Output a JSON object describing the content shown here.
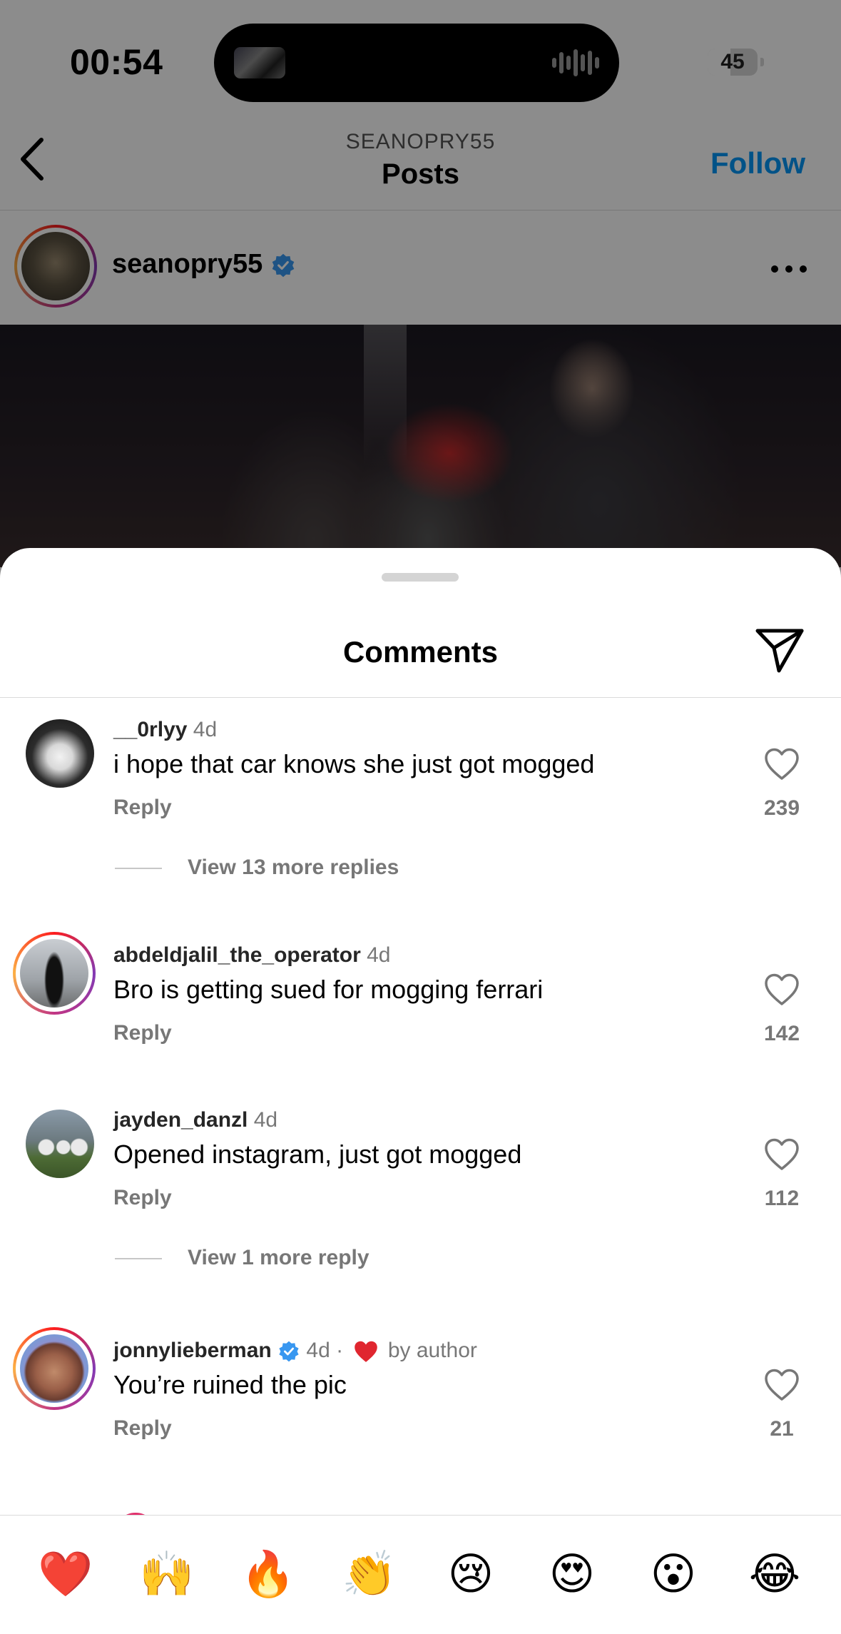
{
  "status_bar": {
    "time": "00:54",
    "battery": "45",
    "battery_level": 0.45
  },
  "nav": {
    "subtitle": "SEANOPRY55",
    "title": "Posts",
    "follow_label": "Follow"
  },
  "post": {
    "username": "seanopry55",
    "verified": true
  },
  "sheet": {
    "title": "Comments"
  },
  "comments": [
    {
      "username": "__0rlyy",
      "time": "4d",
      "text": "i hope that car knows she just got mogged",
      "reply_label": "Reply",
      "likes": "239",
      "more_replies": "View 13 more replies"
    },
    {
      "username": "abdeldjalil_the_operator",
      "time": "4d",
      "text": "Bro is getting sued for mogging ferrari",
      "reply_label": "Reply",
      "likes": "142"
    },
    {
      "username": "jayden_danzl",
      "time": "4d",
      "text": "Opened instagram, just got mogged",
      "reply_label": "Reply",
      "likes": "112",
      "more_replies": "View 1 more reply"
    },
    {
      "username": "jonnylieberman",
      "time": "4d",
      "separator": "·",
      "author_like": "by author",
      "text": "You’re ruined the pic",
      "reply_label": "Reply",
      "likes": "21",
      "verified": true
    }
  ],
  "emoji_bar": [
    "❤️",
    "🙌",
    "🔥",
    "👏",
    "😢",
    "😍",
    "😮",
    "😂"
  ],
  "colors": {
    "accent": "#0095f6",
    "verified": "#3897f0",
    "heart": "#e0262f"
  }
}
